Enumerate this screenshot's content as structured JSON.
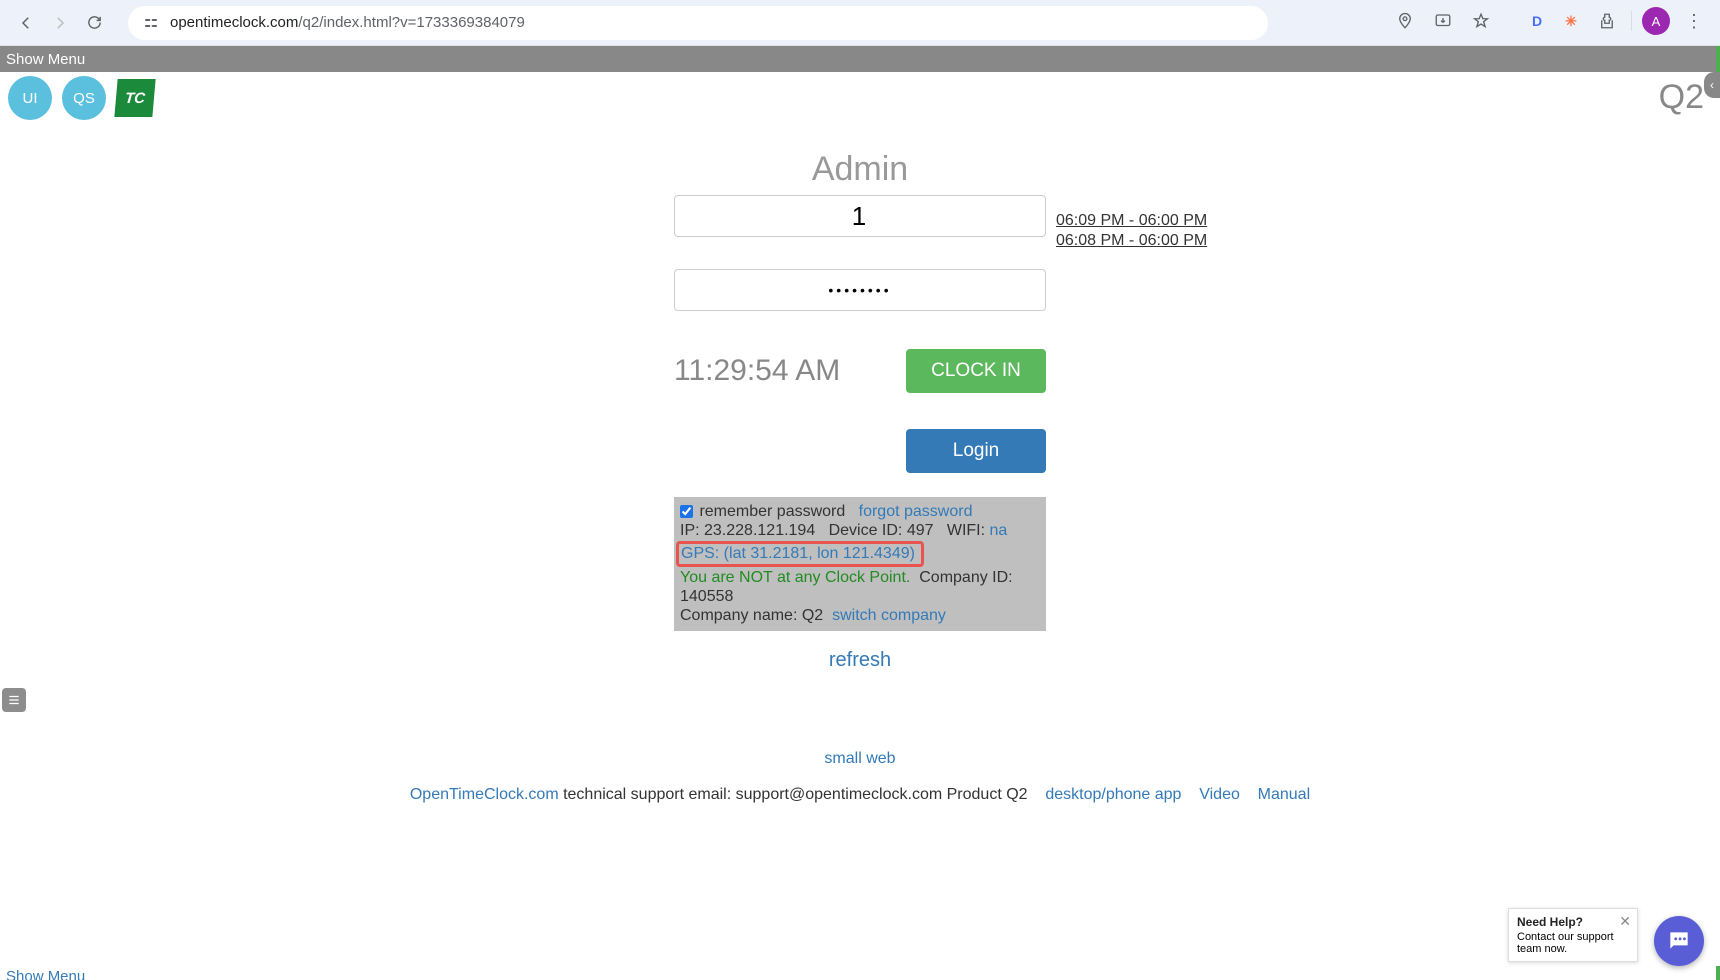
{
  "browser": {
    "url_domain": "opentimeclock.com",
    "url_path": "/q2/index.html?v=1733369384079",
    "avatar_letter": "A",
    "ext1": "D",
    "ext2": "✳"
  },
  "menubar": {
    "show_menu": "Show Menu"
  },
  "badges": {
    "ui": "UI",
    "qs": "QS",
    "logo": "TC"
  },
  "topright_version": "Q2",
  "form": {
    "admin_label": "Admin",
    "username_value": "1",
    "password_masked": "••••••••",
    "current_time": "11:29:54 AM",
    "clock_in": "CLOCK IN",
    "login": "Login"
  },
  "timestamps": [
    "06:09 PM - 06:00 PM",
    "06:08 PM - 06:00 PM"
  ],
  "info": {
    "remember_label": " remember password",
    "forgot_label": "forgot password",
    "ip_label": "IP: 23.228.121.194",
    "device_label": "Device ID: 497",
    "wifi_label": "WIFI: ",
    "wifi_value": "na",
    "gps": "GPS: (lat 31.2181, lon 121.4349)",
    "not_at_clockpoint": "You are NOT at any Clock Point.",
    "company_id": "Company ID: 140558",
    "company_name": "Company name: Q2",
    "switch_company": "switch company"
  },
  "links": {
    "refresh": "refresh",
    "small_web": "small web"
  },
  "footer": {
    "otc": "OpenTimeClock.com",
    "support_text": " technical support email: support@opentimeclock.com Product Q2",
    "desktop": "desktop/phone app",
    "video": "Video",
    "manual": "Manual"
  },
  "help": {
    "title": "Need Help?",
    "subtitle": "Contact our support team now."
  },
  "bottom_menu": "Show Menu"
}
